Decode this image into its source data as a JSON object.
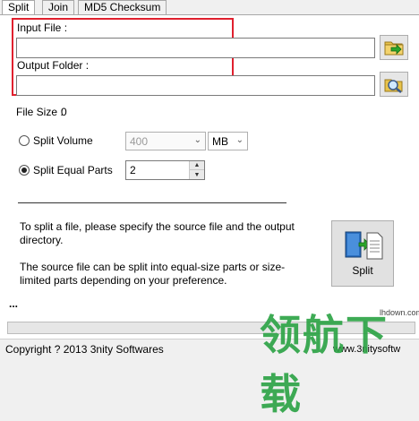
{
  "tabs": [
    {
      "label": "Split",
      "active": true
    },
    {
      "label": "Join",
      "active": false
    },
    {
      "label": "MD5 Checksum",
      "active": false
    }
  ],
  "input_file": {
    "label": "Input File :",
    "value": ""
  },
  "output_folder": {
    "label": "Output Folder :",
    "value": ""
  },
  "file_size": {
    "label": "File Size :",
    "value": "0"
  },
  "split_volume": {
    "label": "Split Volume",
    "selected": false,
    "size_value": "400",
    "unit_value": "MB"
  },
  "split_equal_parts": {
    "label": "Split Equal Parts",
    "selected": true,
    "value": "2"
  },
  "info": {
    "line1": "To split a file, please specify the source file and the output directory.",
    "line2": "The source file can be split into equal-size parts or size-limited parts depending on your preference."
  },
  "split_button": {
    "label": "Split"
  },
  "ellipsis": "...",
  "status": {
    "copyright": "Copyright ? 2013 3nity Softwares",
    "site": "www.3nitysoftw"
  },
  "watermark": {
    "text": "领航下载",
    "site": "lhdown.com"
  },
  "colors": {
    "highlight_box": "#e0202e",
    "watermark": "#2ea447"
  },
  "icons": {
    "browse_file": "folder-arrow-icon",
    "browse_folder": "magnifier-folder-icon",
    "split": "split-docs-icon"
  }
}
